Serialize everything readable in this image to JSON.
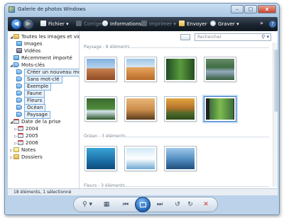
{
  "window": {
    "title": "Galerie de photos Windows"
  },
  "toolbar": {
    "back": "◀",
    "forward": "▶",
    "fichier": "Fichier ▾",
    "corriger": "Corriger",
    "informations": "Informations",
    "imprimer": "Imprimer ▾",
    "envoyer": "Envoyer",
    "graver": "Graver ▾",
    "more": "»",
    "help": "?"
  },
  "sidebar": {
    "items": [
      {
        "label": "Toutes les images et vidéos",
        "icon": "folder-icon"
      },
      {
        "label": "Images",
        "icon": "images-icon"
      },
      {
        "label": "Vidéos",
        "icon": "videos-icon"
      },
      {
        "label": "Récemment importé",
        "icon": "recent-icon"
      },
      {
        "label": "Mots-clés",
        "icon": "tag-icon"
      },
      {
        "label": "Créer un nouveau mot-clé",
        "icon": "tag-icon"
      },
      {
        "label": "Sans mot-clé",
        "icon": "tag-icon"
      },
      {
        "label": "Exemple",
        "icon": "tag-icon"
      },
      {
        "label": "Faune",
        "icon": "tag-icon"
      },
      {
        "label": "Fleurs",
        "icon": "tag-icon"
      },
      {
        "label": "Océan",
        "icon": "tag-icon"
      },
      {
        "label": "Paysage",
        "icon": "tag-icon"
      },
      {
        "label": "Date de la prise",
        "icon": "calendar-icon"
      },
      {
        "label": "2004",
        "icon": "calendar-icon"
      },
      {
        "label": "2005",
        "icon": "calendar-icon"
      },
      {
        "label": "2006",
        "icon": "calendar-icon"
      },
      {
        "label": "Notes",
        "icon": "notes-icon"
      },
      {
        "label": "Dossiers",
        "icon": "folder-icon"
      }
    ]
  },
  "search": {
    "placeholder": "Rechercher"
  },
  "groups": [
    {
      "label": "Paysage - 8 éléments"
    },
    {
      "label": "Océan - 3 éléments"
    },
    {
      "label": "Fleurs - 3 éléments"
    }
  ],
  "status": {
    "text": "18 éléments, 1 sélectionné"
  },
  "bottom_bar": {
    "zoom": "⚲ ▾",
    "grid": "▦",
    "prev": "⏮",
    "next": "⏭",
    "rotate_left": "↺",
    "rotate_right": "↻",
    "delete": "✕"
  },
  "colors": {
    "toolbar_bg": "#1b2530",
    "accent": "#1e62b8",
    "delete": "#d22a2a"
  }
}
